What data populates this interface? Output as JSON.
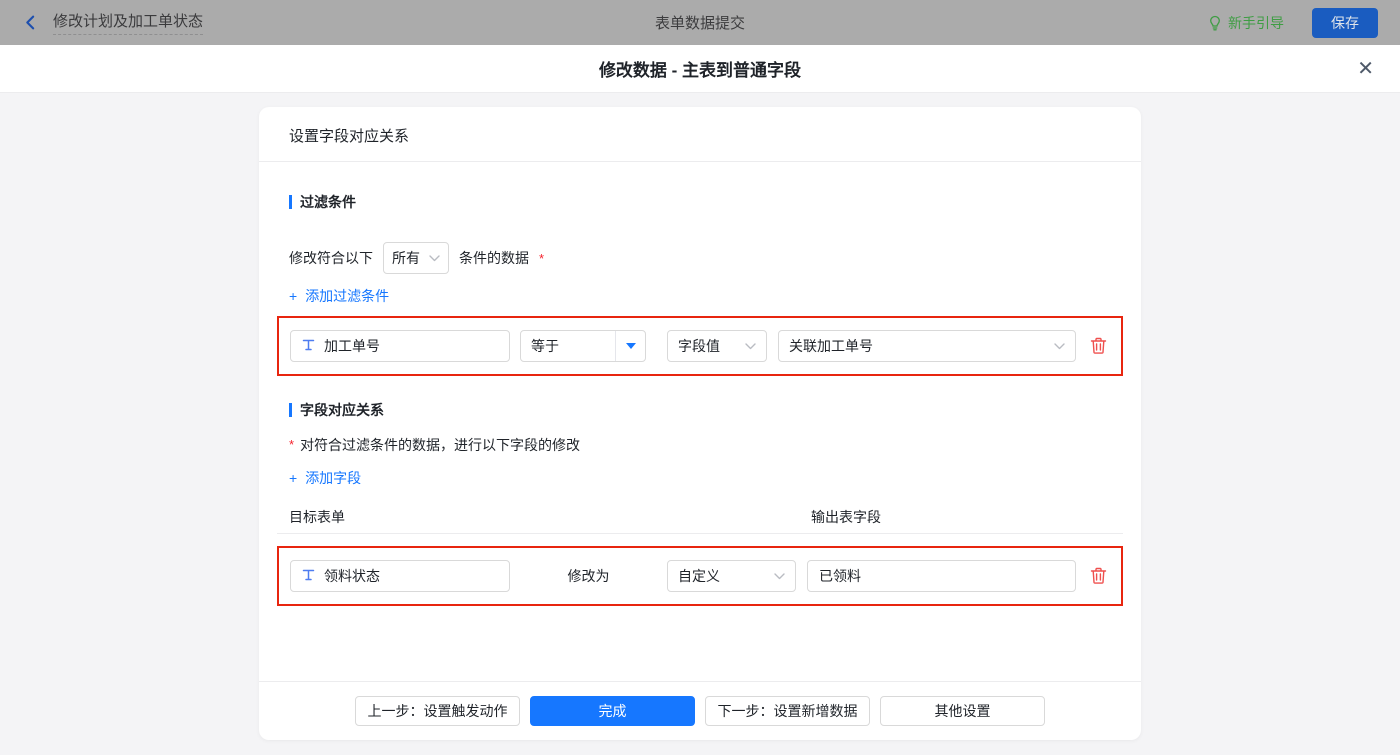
{
  "topbar": {
    "back_title": "修改计划及加工单状态",
    "center_title": "表单数据提交",
    "guide_label": "新手引导",
    "save_label": "保存"
  },
  "modal": {
    "title": "修改数据 - 主表到普通字段",
    "close_icon": "✕"
  },
  "card": {
    "header": "设置字段对应关系",
    "filter_section": {
      "title": "过滤条件",
      "prefix": "修改符合以下",
      "match_select_value": "所有",
      "suffix": "条件的数据",
      "required_mark": "*",
      "add_plus": "+",
      "add_link": "添加过滤条件",
      "row": {
        "field": "加工单号",
        "operator": "等于",
        "value_type": "字段值",
        "value": "关联加工单号"
      }
    },
    "mapping_section": {
      "title": "字段对应关系",
      "required_mark": "*",
      "description": "对符合过滤条件的数据，进行以下字段的修改",
      "add_plus": "+",
      "add_link": "添加字段",
      "col_target": "目标表单",
      "col_output": "输出表字段",
      "row": {
        "field": "领料状态",
        "modify_label": "修改为",
        "value_type": "自定义",
        "value": "已领料"
      }
    },
    "footer": {
      "prev_label": "上一步：设置触发动作",
      "done_label": "完成",
      "next_label": "下一步：设置新增数据",
      "other_label": "其他设置"
    }
  },
  "colors": {
    "accent_blue": "#1677ff",
    "annotation_red": "#e8250f",
    "trash_red": "#ef4f4d",
    "guide_green": "#3f9d44",
    "required_red": "#f5222d",
    "topbar_dimmed_bg": "#ababab",
    "page_bg": "#f4f4f6"
  }
}
